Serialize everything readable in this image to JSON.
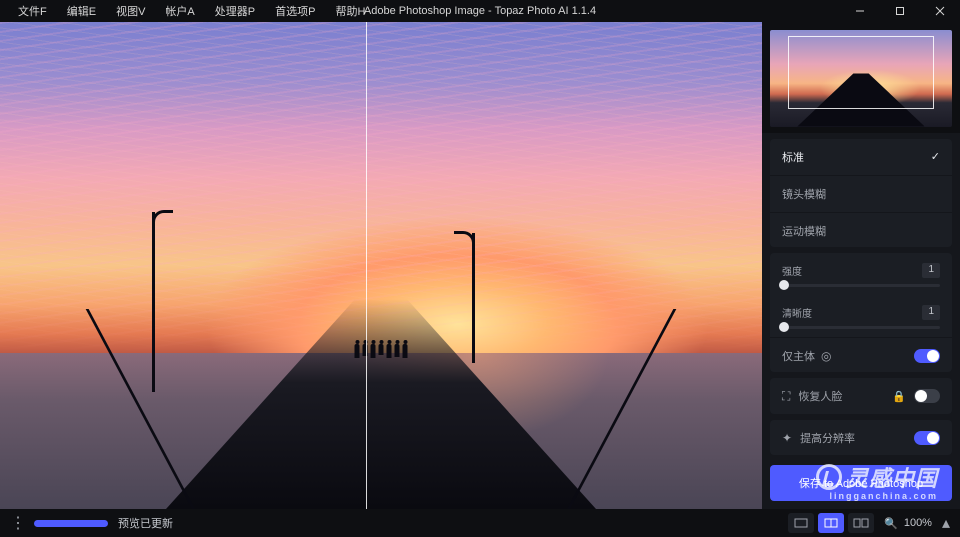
{
  "app": {
    "title": "Adobe Photoshop Image - Topaz Photo AI 1.1.4"
  },
  "menu": {
    "items": [
      "文件F",
      "编辑E",
      "视图V",
      "帐户A",
      "处理器P",
      "首选项P",
      "帮助H"
    ]
  },
  "panel": {
    "modes": {
      "items": [
        {
          "label": "标准",
          "selected": true
        },
        {
          "label": "镜头模糊",
          "selected": false
        },
        {
          "label": "运动模糊",
          "selected": false
        }
      ]
    },
    "sliders": {
      "strength": {
        "label": "强度",
        "value": "1"
      },
      "clarity": {
        "label": "清晰度",
        "value": "1"
      }
    },
    "subjectOnly": {
      "label": "仅主体",
      "icon": "target-icon",
      "on": true
    },
    "recoverFaces": {
      "label": "恢复人脸",
      "icon": "face-detect-icon",
      "locked": true,
      "on": false
    },
    "upscale": {
      "label": "提高分辨率",
      "icon": "sparkle-icon",
      "on": true
    },
    "primaryButton": "保存 to Adobe Photoshop"
  },
  "bottombar": {
    "status": "预览已更新",
    "zoom": "100%",
    "viewModes": {
      "single": false,
      "split": true,
      "sideBySide": false
    }
  },
  "watermark": {
    "text": "灵感中国",
    "sub": "lingganchina.com"
  }
}
